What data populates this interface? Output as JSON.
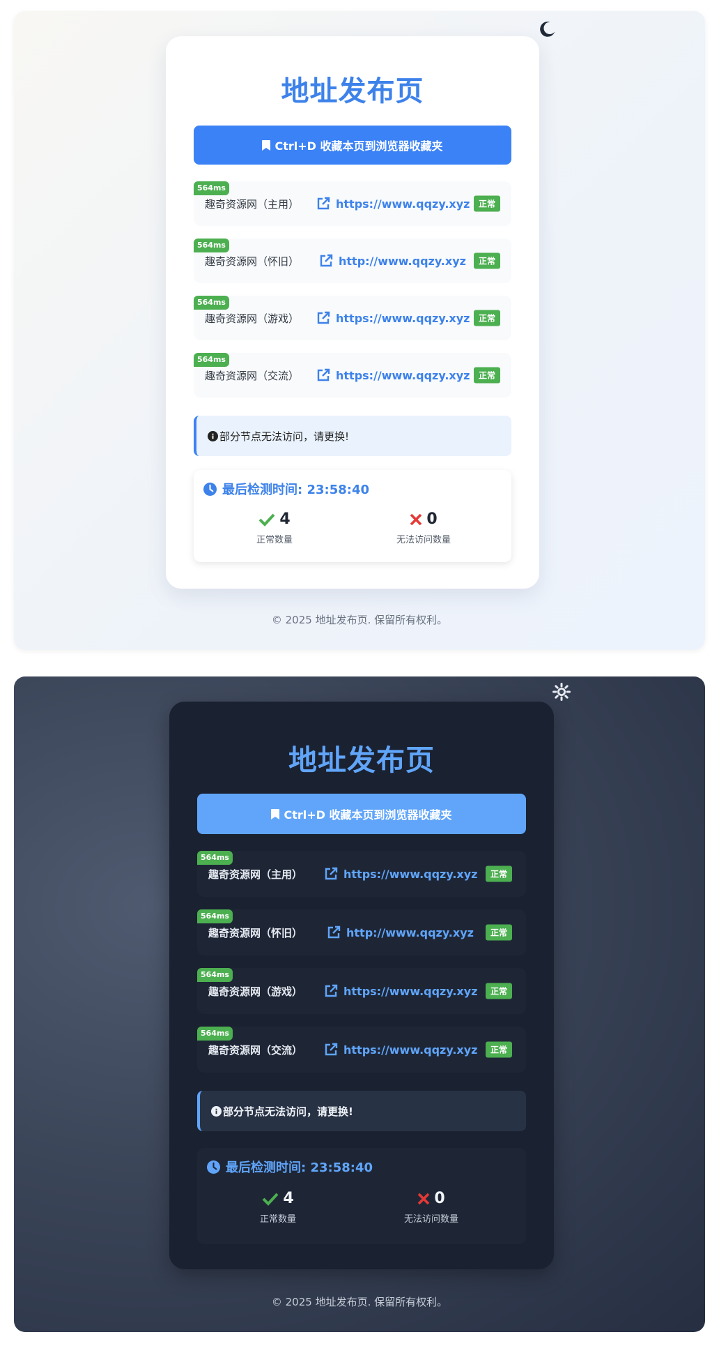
{
  "title": "地址发布页",
  "bookmark_label": "Ctrl+D 收藏本页到浏览器收藏夹",
  "sites": [
    {
      "latency": "564ms",
      "name": "趣奇资源网（主用）",
      "url": "https://www.qqzy.xyz",
      "status": "正常"
    },
    {
      "latency": "564ms",
      "name": "趣奇资源网（怀旧）",
      "url": "http://www.qqzy.xyz",
      "status": "正常"
    },
    {
      "latency": "564ms",
      "name": "趣奇资源网（游戏）",
      "url": "https://www.qqzy.xyz",
      "status": "正常"
    },
    {
      "latency": "564ms",
      "name": "趣奇资源网（交流）",
      "url": "https://www.qqzy.xyz",
      "status": "正常"
    }
  ],
  "notice": "部分节点无法访问，请更换!",
  "summary": {
    "check_time": "最后检测时间: 23:58:40",
    "ok_count": "4",
    "ok_label": "正常数量",
    "fail_count": "0",
    "fail_label": "无法访问数量"
  },
  "footer": "© 2025 地址发布页. 保留所有权利。",
  "colors": {
    "accent_light": "#3b82f6",
    "accent_dark": "#60a5fa",
    "ok_green": "#4caf50",
    "fail_red": "#e53935"
  },
  "icons": {
    "light_toggle": "moon-icon",
    "dark_toggle": "sun-icon",
    "bookmark": "bookmark-icon",
    "link": "external-link-icon",
    "notice": "info-icon",
    "clock": "clock-icon",
    "ok": "check-icon",
    "fail": "x-icon"
  }
}
